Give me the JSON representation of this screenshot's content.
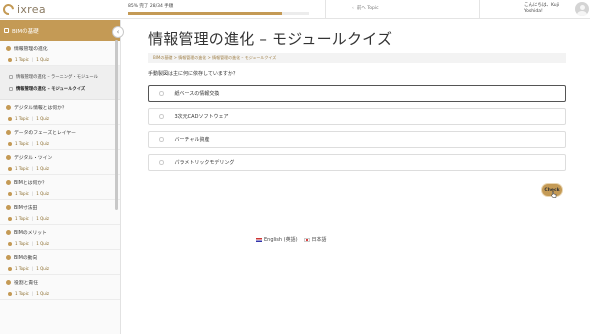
{
  "app": {
    "logo_text": "ixrea",
    "brand_color": "#c49a55"
  },
  "topbar": {
    "progress_text": "85% 完了  28/34 手順",
    "progress_fraction": 0.85,
    "prev_label": "前へ Topic",
    "greeting_line1": "こんにちは、Kuji",
    "greeting_line2": "Yoshida!"
  },
  "sidebar": {
    "header_title": "BIMの基礎",
    "toggle_icon": "‹",
    "meta_topic": "1 Topic",
    "meta_quiz": "1 Quiz",
    "sections": [
      {
        "title": "情報管理の進化",
        "done": true
      },
      {
        "title": "デジタル情報とは何か？",
        "done": true
      },
      {
        "title": "データのフェーズとレイヤー",
        "done": true
      },
      {
        "title": "デジタル・ツイン",
        "done": true
      },
      {
        "title": "BIMとは何か？",
        "done": true
      },
      {
        "title": "BIM寸法田",
        "done": true
      },
      {
        "title": "BIMのメリット",
        "done": true
      },
      {
        "title": "BIMの動向",
        "done": true
      },
      {
        "title": "役割と責任",
        "done": true
      }
    ],
    "topics": [
      {
        "label": "情報管理の進化 – ラーニング・モジュール"
      },
      {
        "label": "情報管理の進化 – モジュールクイズ"
      }
    ]
  },
  "main": {
    "title": "情報管理の進化 – モジュールクイズ",
    "breadcrumb": "BIMの基礎 > 情報管理の進化 > 情報管理の進化 – モジュールクイズ",
    "question": "手動製図は主に何に依存していますか？",
    "options": [
      {
        "label": "紙ベースの情報交換",
        "selected": true
      },
      {
        "label": "3次元CADソフトウェア",
        "selected": false
      },
      {
        "label": "バーチャル資産",
        "selected": false
      },
      {
        "label": "パラメトリックモデリング",
        "selected": false
      }
    ],
    "check_label": "Check"
  },
  "footer": {
    "lang_en": "English (英語)",
    "lang_jp": "日本語"
  }
}
